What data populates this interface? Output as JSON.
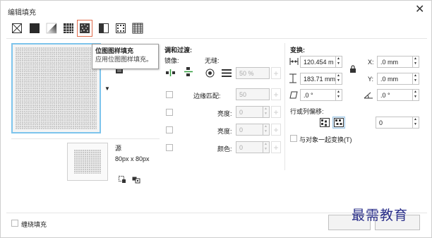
{
  "window": {
    "title": "编辑填充",
    "close_glyph": "✕"
  },
  "fill_types": [
    {
      "name": "no-fill-icon"
    },
    {
      "name": "uniform-fill-icon"
    },
    {
      "name": "fountain-fill-icon"
    },
    {
      "name": "vector-pattern-fill-icon"
    },
    {
      "name": "bitmap-pattern-fill-icon",
      "selected": true
    },
    {
      "name": "two-color-pattern-fill-icon"
    },
    {
      "name": "texture-fill-icon"
    },
    {
      "name": "postscript-fill-icon"
    }
  ],
  "tooltip": {
    "title": "位图图样填充",
    "description": "应用位图图样填充。"
  },
  "blend": {
    "heading": "调和过渡:",
    "mirror_label": "镜像:",
    "seamless_label": "无缝:",
    "seamless_value": "50 %",
    "edge_match_label": "边缘匹配:",
    "edge_match_value": "50",
    "brightness_label": "亮度:",
    "brightness_value": "0",
    "luminance_label": "亮度:",
    "luminance_value": "0",
    "color_label": "颜色:",
    "color_value": "0"
  },
  "transform": {
    "heading": "变换:",
    "width_value": "120.454 m",
    "height_value": "183.71 mm",
    "x_label": "X:",
    "x_value": ".0 mm",
    "y_label": "Y:",
    "y_value": ".0 mm",
    "skew_value": ".0 °",
    "rotate_value": ".0 °",
    "row_col_offset_label": "行或列偏移:",
    "offset_value": "0",
    "transform_with_object_label": "与对象一起变换(T)"
  },
  "source": {
    "label": "源",
    "size": "80px x 80px"
  },
  "footer": {
    "wrap_fill_label": "缠绕填充"
  },
  "watermark": "最需教育"
}
